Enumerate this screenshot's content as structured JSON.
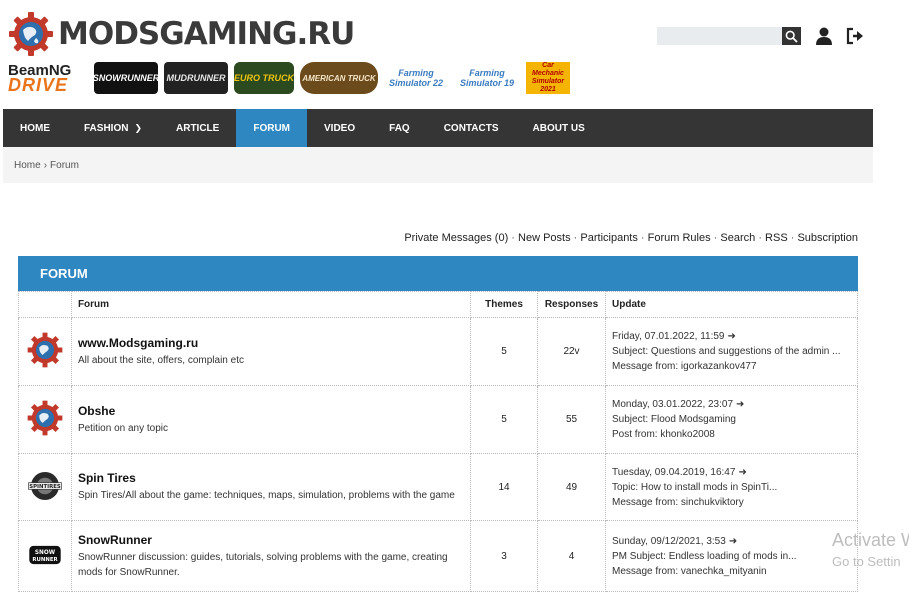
{
  "logo": {
    "text": "MODSGAMING.RU"
  },
  "search": {
    "placeholder": ""
  },
  "games": [
    {
      "name": "BeamNG DRIVE",
      "l1": "BeamNG",
      "l2": "DRIVE"
    },
    {
      "name": "SNOWRUNNER"
    },
    {
      "name": "MUDRUNNER"
    },
    {
      "name": "EURO TRUCK"
    },
    {
      "name": "AMERICAN TRUCK"
    },
    {
      "name": "Farming Simulator 22"
    },
    {
      "name": "Farming Simulator 19"
    },
    {
      "name": "Car Mechanic Simulator 2021"
    }
  ],
  "nav": [
    {
      "label": "HOME"
    },
    {
      "label": "FASHION"
    },
    {
      "label": "ARTICLE"
    },
    {
      "label": "FORUM"
    },
    {
      "label": "VIDEO"
    },
    {
      "label": "FAQ"
    },
    {
      "label": "CONTACTS"
    },
    {
      "label": "ABOUT US"
    }
  ],
  "breadcrumb": {
    "home": "Home",
    "sep": "›",
    "current": "Forum"
  },
  "links": [
    "Private Messages (0)",
    "New Posts",
    "Participants",
    "Forum Rules",
    "Search",
    "RSS",
    "Subscription"
  ],
  "forum": {
    "title": "FORUM",
    "columns": {
      "forum": "Forum",
      "themes": "Themes",
      "responses": "Responses",
      "update": "Update"
    },
    "rows": [
      {
        "title": "www.Modsgaming.ru",
        "desc": "All about the site, offers, complain etc",
        "themes": "5",
        "responses": "22v",
        "date": "Friday, 07.01.2022, 11:59",
        "arrow": "➜",
        "line2": "Subject: Questions and suggestions of the admin ...",
        "line3": "Message from: igorkazankov477"
      },
      {
        "title": "Obshe",
        "desc": "Petition on any topic",
        "themes": "5",
        "responses": "55",
        "date": "Monday, 03.01.2022, 23:07",
        "arrow": "➜",
        "line2": "Subject: Flood Modsgaming",
        "line3": "Post from: khonko2008"
      },
      {
        "title": "Spin Tires",
        "desc": "Spin Tires/All about the game: techniques, maps, simulation, problems with the game",
        "themes": "14",
        "responses": "49",
        "date": "Tuesday, 09.04.2019, 16:47",
        "arrow": "➜",
        "line2": "Topic: How to install mods in SpinTi...",
        "line3": "Message from: sinchukviktory"
      },
      {
        "title": "SnowRunner",
        "desc": "SnowRunner discussion: guides, tutorials, solving problems with the game, creating mods for SnowRunner.",
        "themes": "3",
        "responses": "4",
        "date": "Sunday, 09/12/2021, 3:53",
        "arrow": "➜",
        "line2": "PM Subject: Endless loading of mods in...",
        "line3": "Message from: vanechka_mityanin"
      }
    ]
  },
  "watermark": {
    "line1": "Activate W",
    "line2": "Go to Settin"
  },
  "colors": {
    "accent": "#2e87c1",
    "nav_bg": "#353535",
    "gear": "#c0392b"
  }
}
